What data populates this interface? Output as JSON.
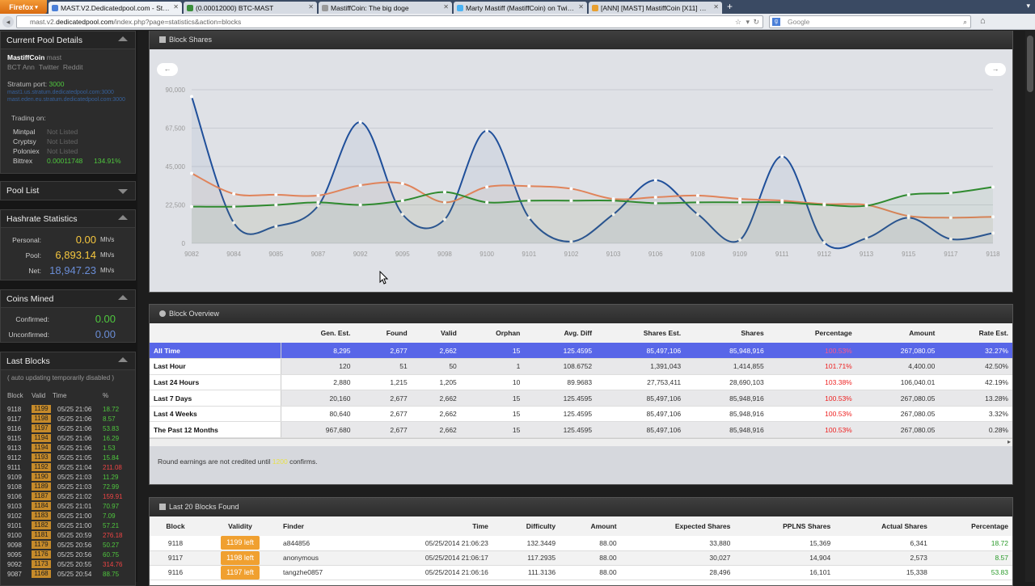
{
  "browser": {
    "app_button": "Firefox",
    "tabs": [
      {
        "label": "MAST.V2.Dedicatedpool.com - Statistics",
        "active": true,
        "icon_color": "#4a7fd8"
      },
      {
        "label": "(0.00012000) BTC-MAST",
        "active": false,
        "icon_color": "#3a8f3a"
      },
      {
        "label": "MastiffCoin: The big doge",
        "active": false,
        "icon_color": "#999999"
      },
      {
        "label": "Marty Mastiff (MastiffCoin) on Twitter",
        "active": false,
        "icon_color": "#4ab3f4"
      },
      {
        "label": "[ANN] [MAST] MastiffCoin [X11] Only 5 d...",
        "active": false,
        "icon_color": "#e8a030"
      }
    ],
    "url_prefix": "mast.v2.",
    "url_domain": "dedicatedpool.com",
    "url_path": "/index.php?page=statistics&action=blocks",
    "search_placeholder": "Google"
  },
  "sidebar": {
    "pool_details": {
      "title": "Current Pool Details",
      "coin_name": "MastiffCoin",
      "coin_symbol": "mast",
      "links": [
        "BCT Ann",
        "Twitter",
        "Reddit"
      ],
      "stratum_label": "Stratum port:",
      "stratum_port": "3000",
      "stratum_urls": [
        "mast1.us.stratum.dedicatedpool.com:3000",
        "mast.eden.eu.stratum.dedicatedpool.com:3000"
      ],
      "trading_label": "Trading on:",
      "exchanges": [
        {
          "name": "Mintpal",
          "value": "Not Listed",
          "change": ""
        },
        {
          "name": "Cryptsy",
          "value": "Not Listed",
          "change": ""
        },
        {
          "name": "Poloniex",
          "value": "Not Listed",
          "change": ""
        },
        {
          "name": "Bittrex",
          "value": "0.00011748",
          "change": "134.91%"
        }
      ]
    },
    "pool_list": {
      "title": "Pool List"
    },
    "hashrate": {
      "title": "Hashrate Statistics",
      "rows": [
        {
          "label": "Personal:",
          "value": "0.00",
          "unit": "Mh/s"
        },
        {
          "label": "Pool:",
          "value": "6,893.14",
          "unit": "Mh/s"
        },
        {
          "label": "Net:",
          "value": "18,947.23",
          "unit": "Mh/s"
        }
      ]
    },
    "coins_mined": {
      "title": "Coins Mined",
      "rows": [
        {
          "label": "Confirmed:",
          "value": "0.00"
        },
        {
          "label": "Unconfirmed:",
          "value": "0.00"
        }
      ]
    },
    "last_blocks": {
      "title": "Last Blocks",
      "note": "( auto updating temporarily disabled )",
      "headers": [
        "Block",
        "Valid",
        "Time",
        "%"
      ],
      "rows": [
        [
          "9118",
          "1199",
          "05/25 21:06",
          "18.72"
        ],
        [
          "9117",
          "1198",
          "05/25 21:06",
          "8.57"
        ],
        [
          "9116",
          "1197",
          "05/25 21:06",
          "53.83"
        ],
        [
          "9115",
          "1194",
          "05/25 21:06",
          "16.29"
        ],
        [
          "9113",
          "1194",
          "05/25 21:06",
          "1.53"
        ],
        [
          "9112",
          "1193",
          "05/25 21:05",
          "15.84"
        ],
        [
          "9111",
          "1192",
          "05/25 21:04",
          "211.08"
        ],
        [
          "9109",
          "1190",
          "05/25 21:03",
          "11.29"
        ],
        [
          "9108",
          "1189",
          "05/25 21:03",
          "72.99"
        ],
        [
          "9106",
          "1187",
          "05/25 21:02",
          "159.91"
        ],
        [
          "9103",
          "1184",
          "05/25 21:01",
          "70.97"
        ],
        [
          "9102",
          "1183",
          "05/25 21:00",
          "7.09"
        ],
        [
          "9101",
          "1182",
          "05/25 21:00",
          "57.21"
        ],
        [
          "9100",
          "1181",
          "05/25 20:59",
          "276.18"
        ],
        [
          "9098",
          "1179",
          "05/25 20:56",
          "50.27"
        ],
        [
          "9095",
          "1176",
          "05/25 20:56",
          "60.75"
        ],
        [
          "9092",
          "1173",
          "05/25 20:55",
          "314.76"
        ],
        [
          "9087",
          "1168",
          "05/25 20:54",
          "88.75"
        ]
      ]
    }
  },
  "block_shares": {
    "title": "Block Shares",
    "prev": "←",
    "next": "→",
    "chart_data": {
      "type": "line",
      "categories": [
        "9082",
        "9084",
        "9085",
        "9087",
        "9092",
        "9095",
        "9098",
        "9100",
        "9101",
        "9102",
        "9103",
        "9106",
        "9108",
        "9109",
        "9111",
        "9112",
        "9113",
        "9115",
        "9117",
        "9118"
      ],
      "ylim": [
        0,
        90000
      ],
      "yticks": [
        "0",
        "22,500",
        "45,000",
        "67,500",
        "90,000"
      ],
      "grid": true,
      "series": [
        {
          "name": "",
          "color": "#1f4f9a",
          "values": [
            86000,
            12000,
            10000,
            22000,
            71000,
            17000,
            14000,
            66000,
            15000,
            1000,
            17000,
            37000,
            17000,
            2000,
            51000,
            500,
            3000,
            15000,
            2500,
            6000
          ]
        },
        {
          "name": "",
          "color": "#e0835a",
          "values": [
            41000,
            29000,
            28500,
            28000,
            34000,
            35000,
            24000,
            33000,
            33500,
            32000,
            26000,
            27000,
            28000,
            26000,
            25000,
            23000,
            22500,
            16000,
            15000,
            15500
          ]
        },
        {
          "name": "",
          "color": "#2f8a2f",
          "values": [
            21500,
            21500,
            22500,
            24000,
            22500,
            25000,
            30000,
            24000,
            25000,
            25000,
            25000,
            23500,
            24000,
            24000,
            24000,
            22500,
            22000,
            28500,
            29500,
            33000
          ]
        }
      ]
    }
  },
  "block_overview": {
    "title": "Block Overview",
    "headers": [
      "",
      "Gen. Est.",
      "Found",
      "Valid",
      "Orphan",
      "Avg. Diff",
      "Shares Est.",
      "Shares",
      "Percentage",
      "Amount",
      "Rate Est."
    ],
    "rows": [
      [
        "All Time",
        "8,295",
        "2,677",
        "2,662",
        "15",
        "125.4595",
        "85,497,106",
        "85,948,916",
        "100.53%",
        "267,080.05",
        "32.27%"
      ],
      [
        "Last Hour",
        "120",
        "51",
        "50",
        "1",
        "108.6752",
        "1,391,043",
        "1,414,855",
        "101.71%",
        "4,400.00",
        "42.50%"
      ],
      [
        "Last 24 Hours",
        "2,880",
        "1,215",
        "1,205",
        "10",
        "89.9683",
        "27,753,411",
        "28,690,103",
        "103.38%",
        "106,040.01",
        "42.19%"
      ],
      [
        "Last 7 Days",
        "20,160",
        "2,677",
        "2,662",
        "15",
        "125.4595",
        "85,497,106",
        "85,948,916",
        "100.53%",
        "267,080.05",
        "13.28%"
      ],
      [
        "Last 4 Weeks",
        "80,640",
        "2,677",
        "2,662",
        "15",
        "125.4595",
        "85,497,106",
        "85,948,916",
        "100.53%",
        "267,080.05",
        "3.32%"
      ],
      [
        "The Past 12 Months",
        "967,680",
        "2,677",
        "2,662",
        "15",
        "125.4595",
        "85,497,106",
        "85,948,916",
        "100.53%",
        "267,080.05",
        "0.28%"
      ]
    ],
    "note_prefix": "Round earnings are not credited until",
    "note_value": "1200",
    "note_suffix": "confirms."
  },
  "last20": {
    "title": "Last 20 Blocks Found",
    "headers": [
      "Block",
      "Validity",
      "Finder",
      "Time",
      "Difficulty",
      "Amount",
      "Expected Shares",
      "PPLNS Shares",
      "Actual Shares",
      "Percentage"
    ],
    "rows": [
      [
        "9118",
        "1199 left",
        "a844856",
        "05/25/2014 21:06:23",
        "132.3449",
        "88.00",
        "33,880",
        "15,369",
        "6,341",
        "18.72"
      ],
      [
        "9117",
        "1198 left",
        "anonymous",
        "05/25/2014 21:06:17",
        "117.2935",
        "88.00",
        "30,027",
        "14,904",
        "2,573",
        "8.57"
      ],
      [
        "9116",
        "1197 left",
        "tangzhe0857",
        "05/25/2014 21:06:16",
        "111.3136",
        "88.00",
        "28,496",
        "16,101",
        "15,338",
        "53.83"
      ]
    ]
  }
}
